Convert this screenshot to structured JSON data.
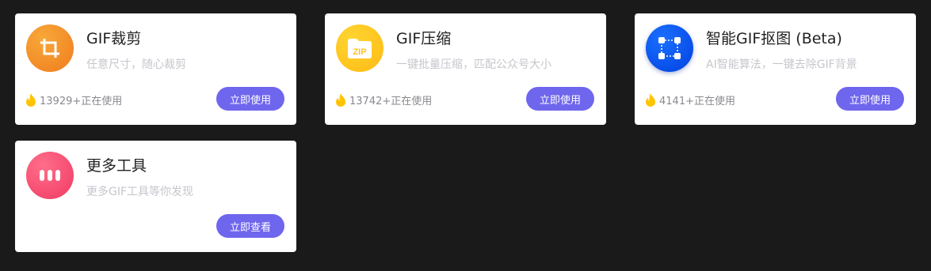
{
  "tools": [
    {
      "title": "GIF裁剪",
      "subtitle": "任意尺寸，随心裁剪",
      "users": "13929+正在使用",
      "button": "立即使用",
      "icon": "crop-icon",
      "icon_colors": [
        "#f7a839",
        "#f07c1e"
      ]
    },
    {
      "title": "GIF压缩",
      "subtitle": "一键批量压缩，匹配公众号大小",
      "users": "13742+正在使用",
      "button": "立即使用",
      "icon": "zip-folder-icon",
      "icon_colors": [
        "#ffd531",
        "#ffba14"
      ]
    },
    {
      "title": "智能GIF抠图 (Beta)",
      "subtitle": "AI智能算法，一键去除GIF背景",
      "users": "4141+正在使用",
      "button": "立即使用",
      "icon": "cutout-icon",
      "icon_colors": [
        "#1b6fff",
        "#0041e0"
      ]
    },
    {
      "title": "更多工具",
      "subtitle": "更多GIF工具等你发现",
      "users": "",
      "button": "立即查看",
      "icon": "more-icon",
      "icon_colors": [
        "#ff6e8a",
        "#f03a63"
      ]
    }
  ],
  "colors": {
    "page_background": "#1a1a1a",
    "card_background": "#ffffff",
    "button": "#6f66ee",
    "flame": "#ffc400"
  }
}
